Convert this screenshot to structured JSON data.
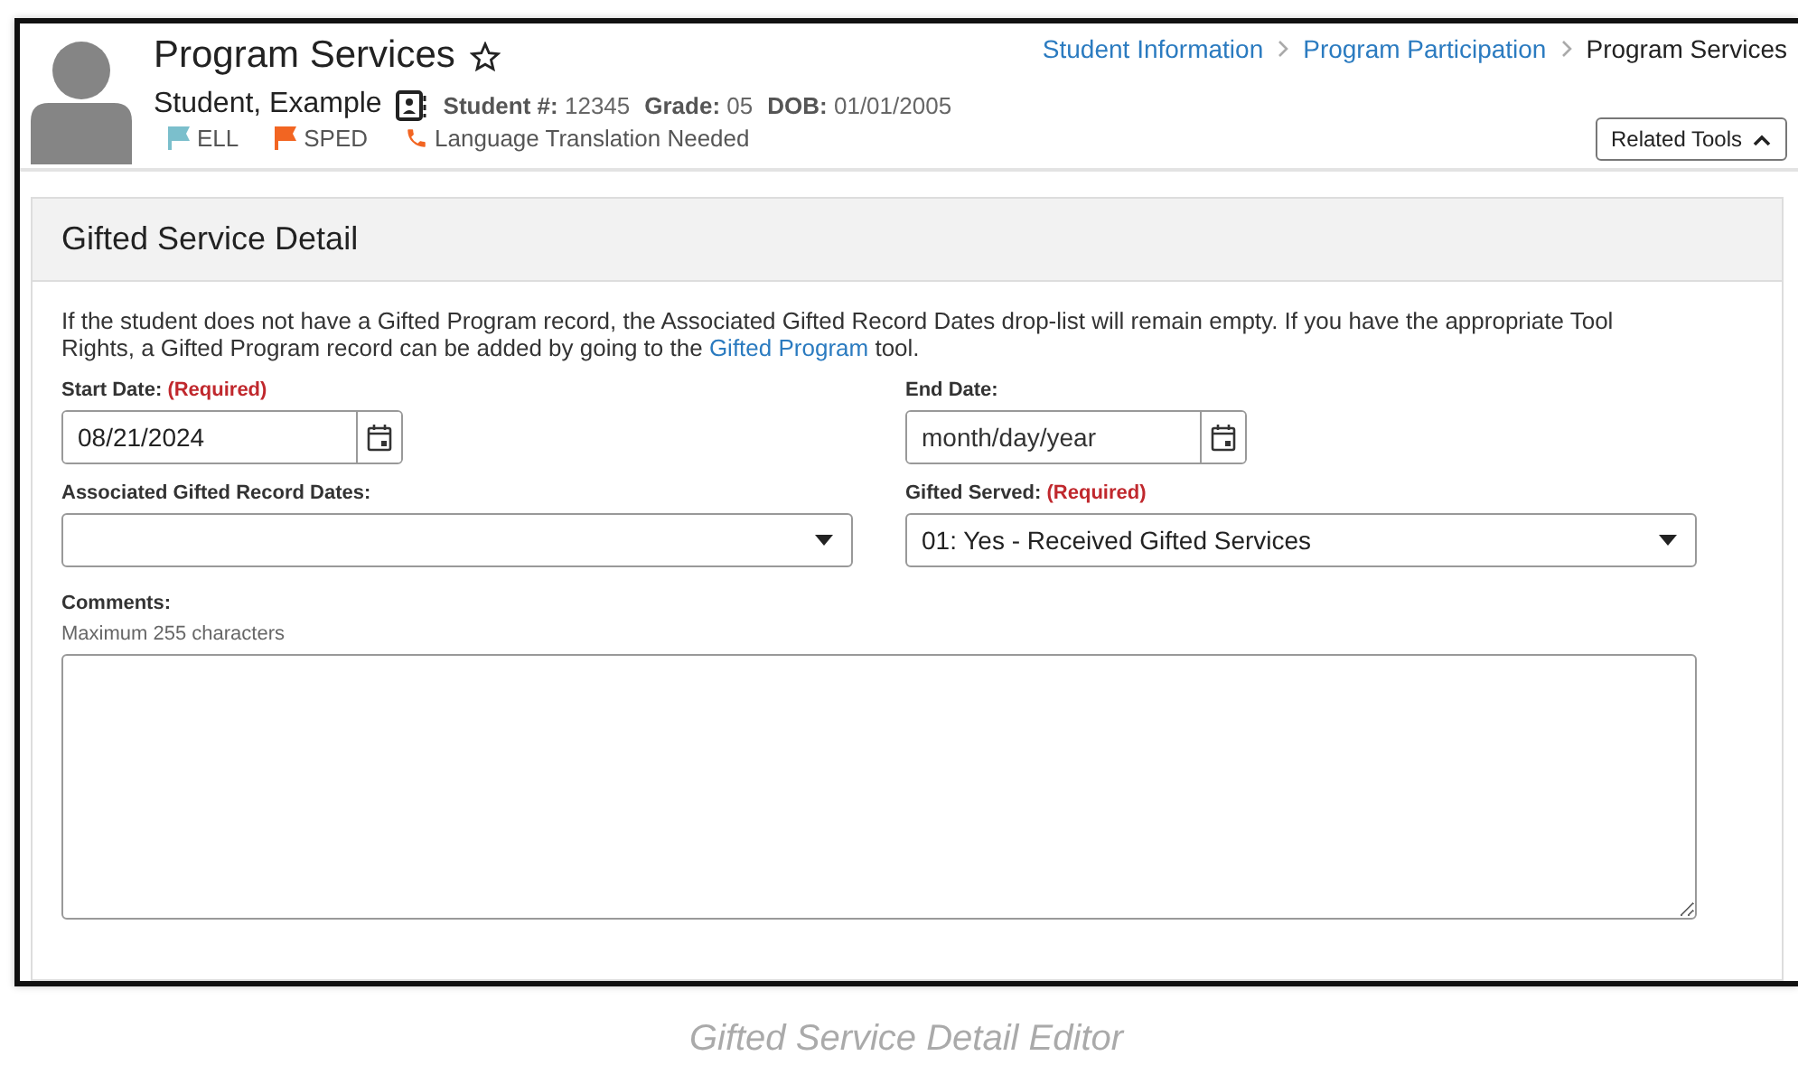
{
  "header": {
    "title": "Program Services",
    "favorite": false,
    "breadcrumbs": [
      {
        "label": "Student Information",
        "kind": "link"
      },
      {
        "label": "Program Participation",
        "kind": "link"
      },
      {
        "label": "Program Services",
        "kind": "current"
      }
    ],
    "student_name": "Student, Example",
    "student_fields": [
      {
        "label": "Student #:",
        "value": "12345"
      },
      {
        "label": "Grade:",
        "value": "05"
      },
      {
        "label": "DOB:",
        "value": "01/01/2005"
      }
    ],
    "flags": [
      {
        "label": "ELL",
        "kind": "flag",
        "color": "#7bbfcc"
      },
      {
        "label": "SPED",
        "kind": "flag",
        "color": "#f26522"
      },
      {
        "label": "Language Translation Needed",
        "kind": "phone",
        "color": "#f26522"
      }
    ],
    "related_tools": {
      "label": "Related Tools",
      "expanded": true
    }
  },
  "card": {
    "title": "Gifted Service Detail",
    "intro": {
      "before": "If the student does not have a Gifted Program record, the Associated Gifted Record Dates drop-list will remain empty. If you have the appropriate Tool Rights, a Gifted Program record can be added by going to the ",
      "link": "Gifted Program",
      "after": " tool."
    },
    "fields": [
      {
        "kind": "date",
        "label": "Start Date:",
        "required": "(Required)",
        "value": "08/21/2024"
      },
      {
        "kind": "date",
        "label": "End Date:",
        "placeholder": "month/day/year"
      },
      {
        "kind": "select",
        "label": "Associated Gifted Record Dates:"
      },
      {
        "kind": "select",
        "label": "Gifted Served:",
        "required": "(Required)",
        "value": "01: Yes - Received Gifted Services"
      }
    ],
    "comments": {
      "label": "Comments:",
      "hint": "Maximum 255 characters"
    }
  },
  "caption": "Gifted Service Detail Editor"
}
